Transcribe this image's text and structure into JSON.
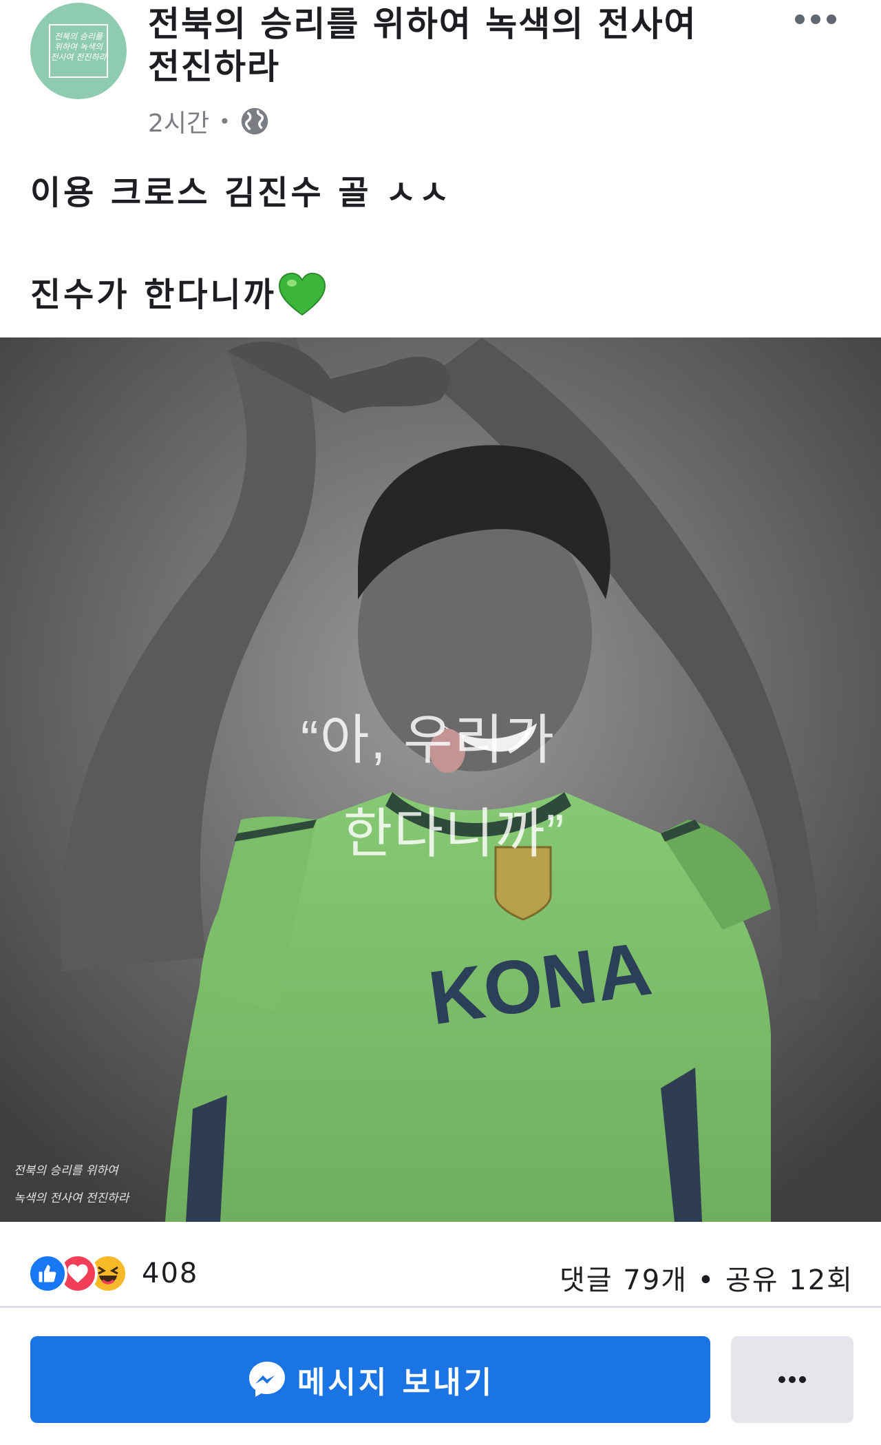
{
  "page": {
    "name": "전북의 승리를 위하여 녹색의 전사여 전진하라",
    "avatar_text": "전북의 승리를 위하여 녹색의 전사여 전진하라",
    "time": "2시간",
    "separator": "•"
  },
  "post": {
    "line1": "이용 크로스 김진수 골 ㅅㅅ",
    "line2": "진수가 한다니까"
  },
  "image": {
    "quote_line1": "“아, 우리가",
    "quote_line2": "한다니까”",
    "jersey_text": "KONA",
    "watermark_line1": "전북의 승리를 위하여",
    "watermark_line2": "녹색의 전사여 전진하라"
  },
  "stats": {
    "reaction_count": "408",
    "comments_shares": "댓글 79개 • 공유 12회"
  },
  "actions": {
    "message_label": "메시지 보내기"
  },
  "colors": {
    "brand_blue": "#1b74e4",
    "like": "#1877f2",
    "love": "#f33e58",
    "haha": "#f7b928",
    "jersey_green": "#7fc26a",
    "avatar_green": "#8fcbb0"
  },
  "icons": [
    "more-icon",
    "globe-icon",
    "green-heart-icon",
    "like-icon",
    "love-icon",
    "haha-icon",
    "messenger-icon"
  ]
}
